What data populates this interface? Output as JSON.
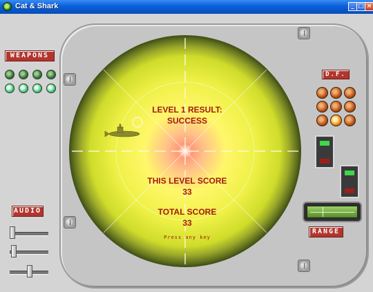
{
  "window": {
    "title": "Cat & Shark",
    "min_glyph": "_",
    "max_glyph": "□",
    "close_glyph": "×"
  },
  "panel": {
    "weapons_label": "WEAPONS",
    "audio_label": "AUDIO",
    "df_label": "D.F.",
    "range_label": "RANGE"
  },
  "radar": {
    "result_line1": "LEVEL 1 RESULT:",
    "result_line2": "SUCCESS",
    "level_score_label": "THIS LEVEL SCORE",
    "level_score_value": "33",
    "total_score_label": "TOTAL SCORE",
    "total_score_value": "33",
    "prompt": "Press any key"
  },
  "colors": {
    "radar_bright": "#ffff70",
    "radar_mid": "#d8e22a",
    "radar_dark": "#6b7a1e",
    "text_red": "#a21a12",
    "plate_red": "#b2362e"
  }
}
